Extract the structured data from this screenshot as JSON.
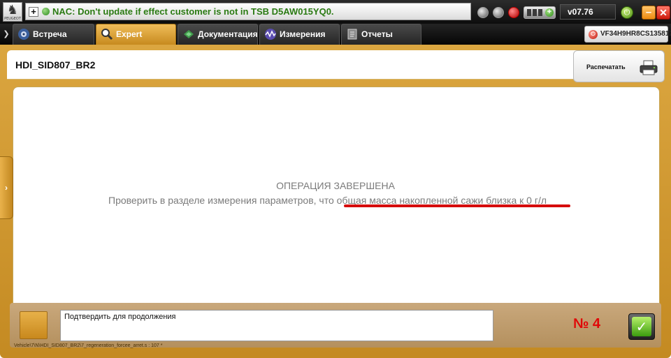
{
  "topbar": {
    "logo_text": "PEUGEOT",
    "message": "NAC: Don't update if effect customer is not in TSB D5AW015YQ0.",
    "plus_symbol": "+",
    "battery_plus": "+",
    "version": "v07.76",
    "minimize_symbol": "–",
    "close_symbol": "✕",
    "power_symbol": "⏻",
    "colors": {
      "message_text": "#2a7a12",
      "close": "#cc1a0b",
      "minimize": "#ee8b12",
      "power": "#4b8d10"
    }
  },
  "tabs": [
    {
      "label": "Встреча",
      "icon": "car-wheel-icon",
      "active": false
    },
    {
      "label": "Expert",
      "icon": "magnifier-icon",
      "active": true
    },
    {
      "label": "Документация",
      "icon": "book-icon",
      "active": false
    },
    {
      "label": "Измерения",
      "icon": "waveform-icon",
      "active": false
    },
    {
      "label": "Отчеты",
      "icon": "report-icon",
      "active": false
    }
  ],
  "tabbar": {
    "chevron": "❯",
    "vin": "VF34H9HR8CS135812",
    "vin_icon": "⏻",
    "active_tab_color": "#dba640"
  },
  "header": {
    "title": "HDI_SID807_BR2",
    "print_label": "Распечатать"
  },
  "side_handle": {
    "symbol": "›"
  },
  "main": {
    "status_title": "ОПЕРАЦИЯ ЗАВЕРШЕНА",
    "instruction": "Проверить в разделе измерения параметров, что общая масса накопленной сажи близка к 0 г/л",
    "highlight_color": "#d60c0c"
  },
  "bottom": {
    "confirm_text": "Подтвердить для продолжения",
    "step_label": "№ 4",
    "ok_symbol": "✓",
    "path": "Vehicle\\7\\N\\HDI_SID807_BR2\\7_regeneration_forcee_arret.s : 107 *"
  }
}
